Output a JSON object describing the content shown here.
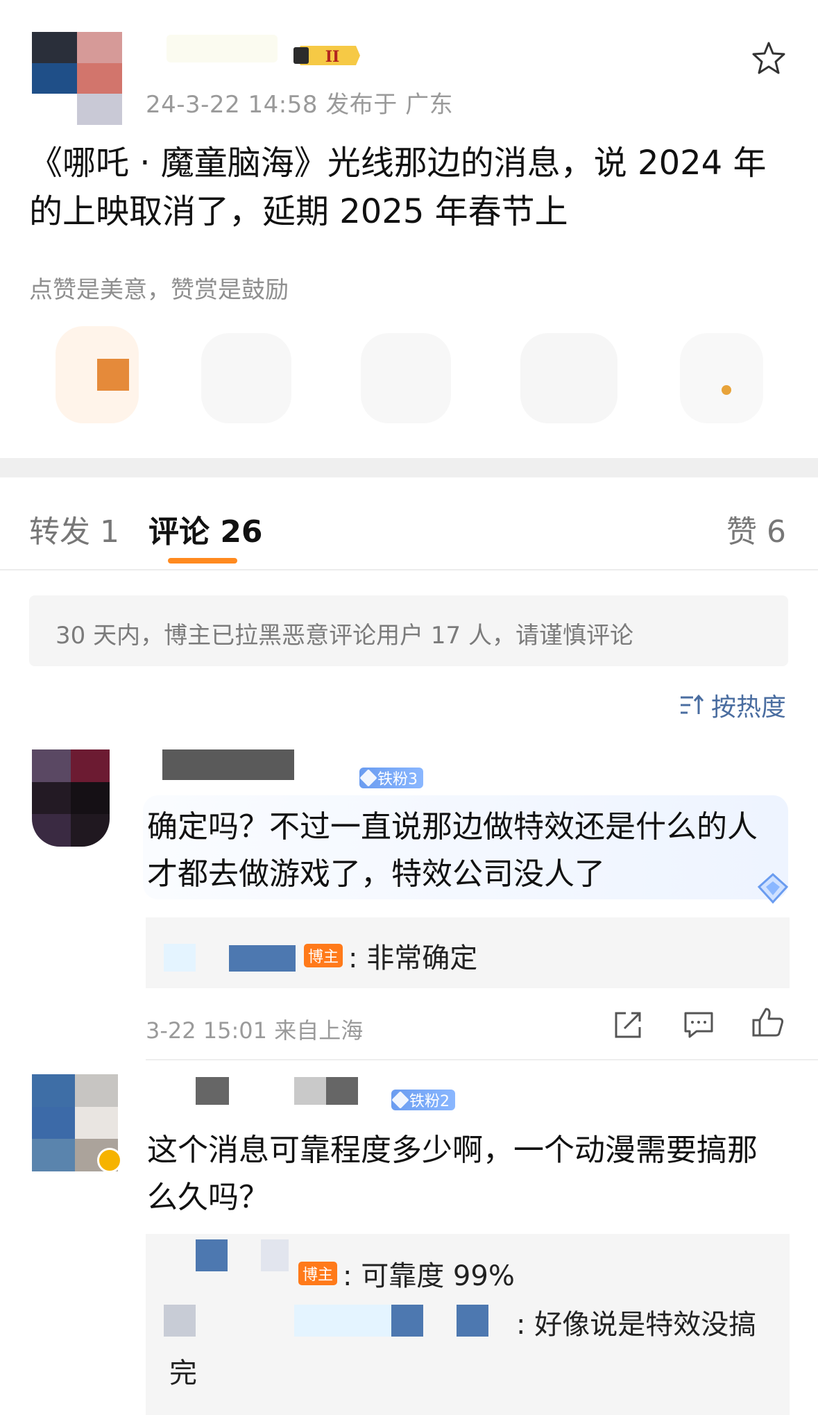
{
  "post": {
    "level_badge": "II",
    "time_location": "24-3-22 14:58  发布于 广东",
    "text": "《哪吒 · 魔童脑海》光线那边的消息，说 2024 年的上映取消了，延期 2025 年春节上",
    "reward_hint": "点赞是美意，赞赏是鼓励"
  },
  "tabs": {
    "repost": "转发 1",
    "comments": "评论 26",
    "likes": "赞 6"
  },
  "notice": "30 天内，博主已拉黑恶意评论用户 17 人，请谨慎评论",
  "sort_label": "按热度",
  "comments": [
    {
      "fan_badge": "铁粉3",
      "text": "确定吗？不过一直说那边做特效还是什么的人才都去做游戏了，特效公司没人了",
      "replies": [
        {
          "badge": "博主",
          "text": ": 非常确定"
        }
      ],
      "meta": "3-22 15:01 来自上海"
    },
    {
      "fan_badge": "铁粉2",
      "text": "这个消息可靠程度多少啊，一个动漫需要搞那么久吗？",
      "replies": [
        {
          "badge": "博主",
          "text": ": 可靠度 99%"
        },
        {
          "badge": "",
          "text": ": 好像说是特效没搞完"
        }
      ]
    }
  ],
  "icons": {
    "star": "star-icon",
    "sort": "sort-icon",
    "share": "share-icon",
    "comment": "comment-icon",
    "like": "thumb-up-icon"
  },
  "colors": {
    "accent": "#ff8a1f",
    "link": "#4a6da0",
    "fan_badge": "#6a9cf0",
    "host_badge": "#ff7a1a"
  }
}
